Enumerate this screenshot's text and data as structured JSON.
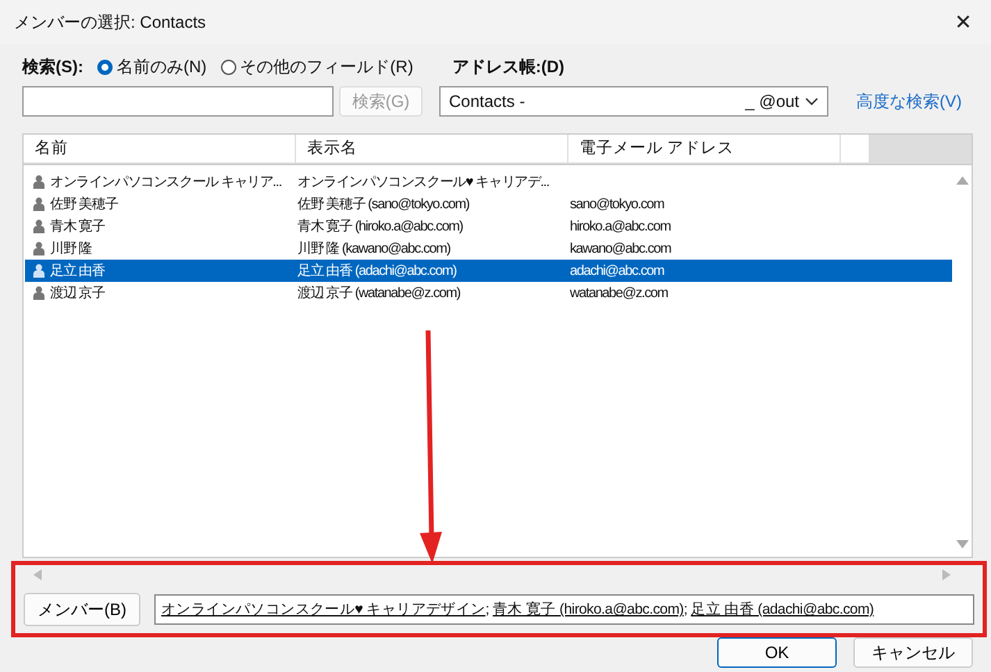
{
  "window": {
    "title": "メンバーの選択: Contacts",
    "close": "✕"
  },
  "search": {
    "label": "検索(S):",
    "options": [
      {
        "label": "名前のみ(N)",
        "selected": true
      },
      {
        "label": "その他のフィールド(R)",
        "selected": false
      }
    ],
    "button": "検索(G)",
    "button_disabled": true
  },
  "address_book": {
    "label": "アドレス帳:(D)",
    "value": "Contacts -",
    "value_end": "_  @out",
    "advanced": "高度な検索(V)"
  },
  "table": {
    "columns": [
      "名前",
      "表示名",
      "電子メール アドレス"
    ],
    "rows": [
      {
        "name": "オンラインパソコンスクール キャリア...",
        "display": "オンラインパソコンスクール♥ キャリアデ...",
        "selected": false
      },
      {
        "name": "佐野 美穂子",
        "display": "佐野 美穂子 (sano@tokyo.com)",
        "email": "sano@tokyo.com",
        "selected": false
      },
      {
        "name": "青木 寛子",
        "display": "青木 寛子 (hiroko.a@abc.com)",
        "email": "hiroko.a@abc.com",
        "selected": false
      },
      {
        "name": "川野 隆",
        "display": "川野 隆 (kawano@abc.com)",
        "email": "kawano@abc.com",
        "selected": false
      },
      {
        "name": "足立 由香",
        "display": "足立 由香 (adachi@abc.com)",
        "email": "adachi@abc.com",
        "selected": true
      },
      {
        "name": "渡辺 京子",
        "display": "渡辺 京子 (watanabe@z.com)",
        "email": "watanabe@z.com",
        "selected": false
      }
    ]
  },
  "members": {
    "button": "メンバー(B)",
    "items": [
      {
        "text": "オンラインパソコンスクール♥ キャリアデザイン",
        "separator": "; "
      },
      {
        "text": "青木 寛子 (hiroko.a@abc.com)",
        "separator": "; "
      },
      {
        "text": "足立 由香 (adachi@abc.com)"
      }
    ]
  },
  "buttons": [
    {
      "label": "OK",
      "kind": "default"
    },
    {
      "label": "キャンセル",
      "kind": "normal"
    }
  ]
}
